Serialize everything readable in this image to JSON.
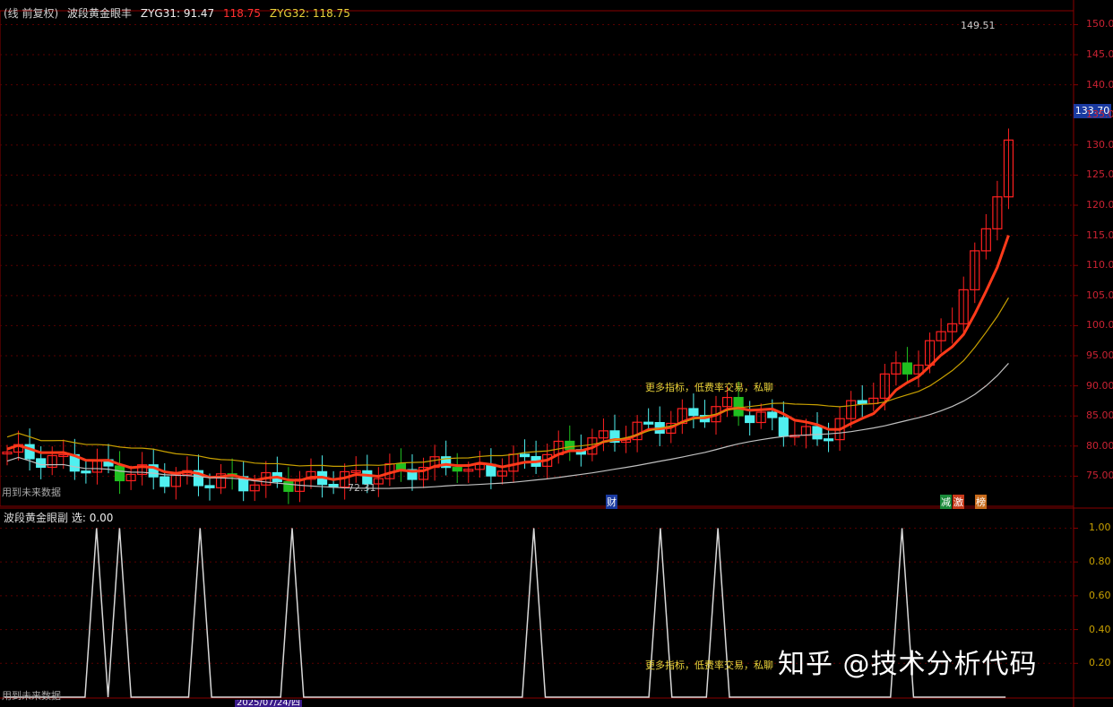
{
  "header": {
    "mode": "(线 前复权)",
    "indicator": "波段黄金眼丰",
    "zyg31_label": "ZYG31: 91.47",
    "zyg31_extra": "118.75",
    "zyg32_label": "ZYG32: 118.75"
  },
  "sub_header": {
    "indicator": "波段黄金眼副",
    "value_label": "选: 0.00"
  },
  "main_footer": "用到未来数据",
  "sub_footer": "用到未来数据",
  "promo_text": "更多指标，低费率交易，私聊",
  "low_marker": "72.31",
  "high_marker": "149.51",
  "current_price": "133.70",
  "tags": {
    "cai": "财",
    "jian": "减",
    "ji": "激",
    "bang": "榜"
  },
  "bottom_axis": {
    "date_label": "2025/07/24/四"
  },
  "watermark": "知乎 @技术分析代码",
  "colors": {
    "up": "#ff2020",
    "down": "#50f0f0",
    "green": "#20c020",
    "ma_yellow": "#c8a000",
    "ma_white": "#c0c0c0",
    "axis": "#8a0000"
  },
  "chart_data": [
    {
      "type": "candlestick",
      "y_ticks": [
        "150.00",
        "145.00",
        "140.00",
        "135.00",
        "130.00",
        "125.00",
        "120.00",
        "115.00",
        "110.00",
        "105.00",
        "100.00",
        "95.00",
        "90.00",
        "85.00",
        "80.00",
        "75.00"
      ],
      "ylim": [
        70,
        152
      ],
      "grid": true
    },
    {
      "type": "line",
      "y_ticks": [
        "1.00",
        "0.80",
        "0.60",
        "0.40",
        "0.20"
      ],
      "ylim": [
        0,
        1.05
      ],
      "series": [
        {
          "values": [
            0,
            0,
            0,
            0,
            0,
            0,
            0,
            0,
            1,
            0,
            1,
            0,
            0,
            0,
            0,
            0,
            0,
            1,
            0,
            0,
            0,
            0,
            0,
            0,
            0,
            1,
            0,
            0,
            0,
            0,
            0,
            0,
            0,
            0,
            0,
            0,
            0,
            0,
            0,
            0,
            0,
            0,
            0,
            0,
            0,
            0,
            1,
            0,
            0,
            0,
            0,
            0,
            0,
            0,
            0,
            0,
            0,
            1,
            0,
            0,
            0,
            0,
            1,
            0,
            0,
            0,
            0,
            0,
            0,
            0,
            0,
            0,
            0,
            0,
            0,
            0,
            0,
            0,
            1,
            0,
            0,
            0,
            0,
            0,
            0,
            0,
            0,
            0
          ]
        }
      ]
    }
  ]
}
